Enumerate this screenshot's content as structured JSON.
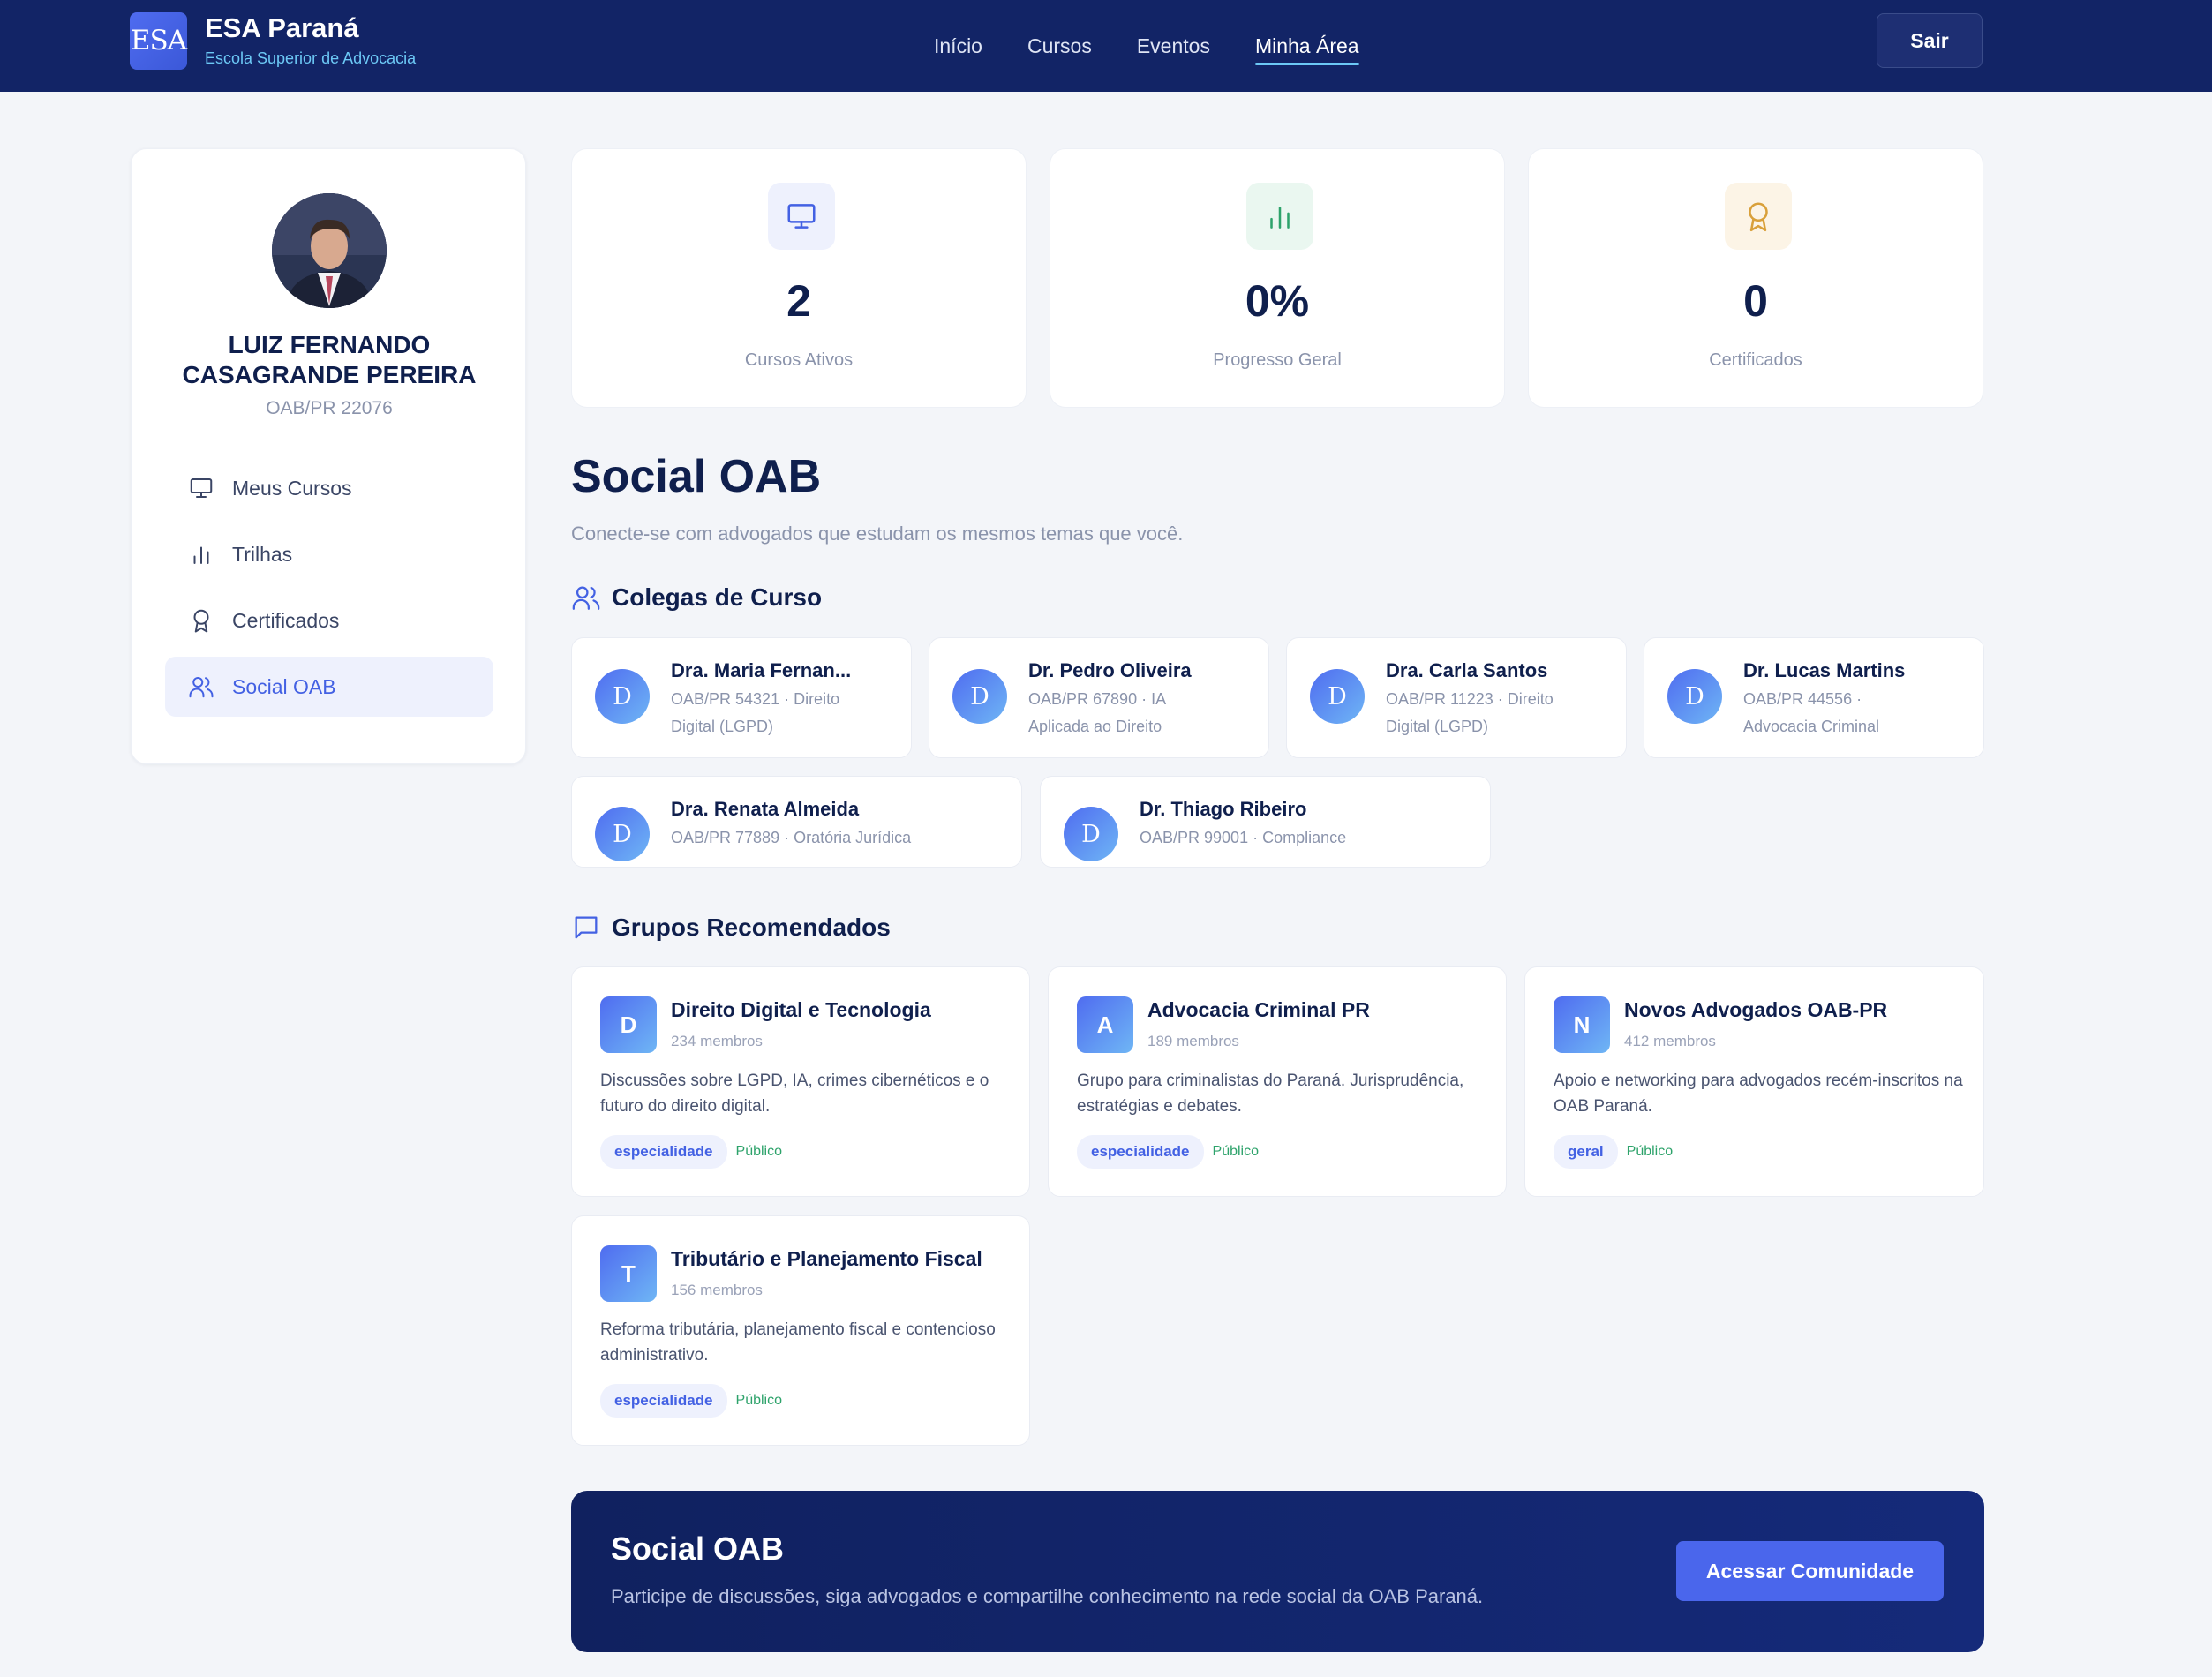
{
  "brand": {
    "logo_text": "ESA",
    "title": "ESA Paraná",
    "subtitle": "Escola Superior de Advocacia"
  },
  "nav": {
    "links": [
      "Início",
      "Cursos",
      "Eventos",
      "Minha Área"
    ],
    "active": "Minha Área",
    "logout_label": "Sair"
  },
  "profile": {
    "name": "LUIZ FERNANDO CASAGRANDE PEREIRA",
    "oab": "OAB/PR 22076"
  },
  "sidebar": {
    "items": [
      {
        "label": "Meus Cursos",
        "icon": "monitor-icon"
      },
      {
        "label": "Trilhas",
        "icon": "bar-chart-icon"
      },
      {
        "label": "Certificados",
        "icon": "award-icon"
      },
      {
        "label": "Social OAB",
        "icon": "users-icon",
        "active": true
      }
    ]
  },
  "stats": [
    {
      "value": "2",
      "label": "Cursos Ativos",
      "icon": "monitor-icon",
      "color": "#4361e3",
      "bg": "#eef1fd"
    },
    {
      "value": "0%",
      "label": "Progresso Geral",
      "icon": "bar-chart-icon",
      "color": "#2ea36b",
      "bg": "#eaf7f0"
    },
    {
      "value": "0",
      "label": "Certificados",
      "icon": "award-icon",
      "color": "#d9a03a",
      "bg": "#fcf4e6"
    }
  ],
  "social": {
    "title": "Social OAB",
    "subtitle": "Conecte-se com advogados que estudam os mesmos temas que você.",
    "colleagues_title": "Colegas de Curso",
    "groups_title": "Grupos Recomendados"
  },
  "colleagues": [
    {
      "initial": "D",
      "name": "Dra. Maria Fernan...",
      "detail_1": "OAB/PR 54321 · Direito",
      "detail_2": "Digital (LGPD)"
    },
    {
      "initial": "D",
      "name": "Dr. Pedro Oliveira",
      "detail_1": "OAB/PR 67890 · IA",
      "detail_2": "Aplicada ao Direito"
    },
    {
      "initial": "D",
      "name": "Dra. Carla Santos",
      "detail_1": "OAB/PR 11223 · Direito",
      "detail_2": "Digital (LGPD)"
    },
    {
      "initial": "D",
      "name": "Dr. Lucas Martins",
      "detail_1": "OAB/PR 44556 ·",
      "detail_2": "Advocacia Criminal"
    },
    {
      "initial": "D",
      "name": "Dra. Renata Almeida",
      "detail_1": "OAB/PR 77889 · Oratória Jurídica",
      "detail_2": ""
    },
    {
      "initial": "D",
      "name": "Dr. Thiago Ribeiro",
      "detail_1": "OAB/PR 99001 · Compliance",
      "detail_2": ""
    }
  ],
  "groups": [
    {
      "initial": "D",
      "name": "Direito Digital e Tecnologia",
      "members": "234 membros",
      "description": "Discussões sobre LGPD, IA, crimes cibernéticos e o futuro do direito digital.",
      "tag": "especialidade",
      "visibility": "Público"
    },
    {
      "initial": "A",
      "name": "Advocacia Criminal PR",
      "members": "189 membros",
      "description": "Grupo para criminalistas do Paraná. Jurisprudência, estratégias e debates.",
      "tag": "especialidade",
      "visibility": "Público"
    },
    {
      "initial": "N",
      "name": "Novos Advogados OAB-PR",
      "members": "412 membros",
      "description": "Apoio e networking para advogados recém-inscritos na OAB Paraná.",
      "tag": "geral",
      "visibility": "Público"
    },
    {
      "initial": "T",
      "name": "Tributário e Planejamento Fiscal",
      "members": "156 membros",
      "description": "Reforma tributária, planejamento fiscal e contencioso administrativo.",
      "tag": "especialidade",
      "visibility": "Público"
    }
  ],
  "cta": {
    "title": "Social OAB",
    "subtitle": "Participe de discussões, siga advogados e compartilhe conhecimento na rede social da OAB Paraná.",
    "button_label": "Acessar Comunidade"
  }
}
